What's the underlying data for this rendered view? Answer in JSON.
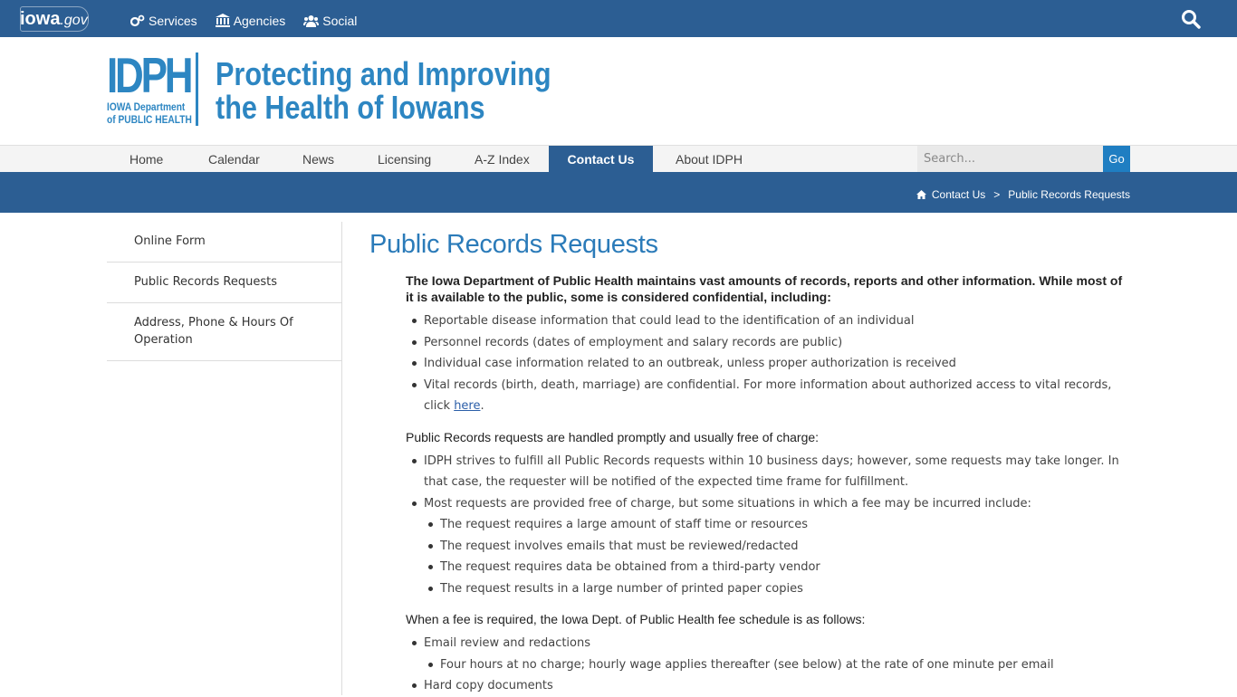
{
  "topbar": {
    "logo_main": "iowa",
    "logo_suffix": ".gov",
    "nav": [
      {
        "label": "Services",
        "icon": "gears-icon"
      },
      {
        "label": "Agencies",
        "icon": "building-icon"
      },
      {
        "label": "Social",
        "icon": "users-icon"
      }
    ],
    "search_icon": "search-icon"
  },
  "header": {
    "logo_letters": "IDPH",
    "logo_line1": "IOWA Department",
    "logo_line2": "of PUBLIC HEALTH",
    "tagline_line1": "Protecting and Improving",
    "tagline_line2": "the Health of Iowans"
  },
  "mainnav": {
    "items": [
      "Home",
      "Calendar",
      "News",
      "Licensing",
      "A-Z Index",
      "Contact Us",
      "About IDPH"
    ],
    "active": "Contact Us",
    "search_placeholder": "Search...",
    "go_label": "Go"
  },
  "breadcrumb": {
    "home_icon": "home-icon",
    "crumbs": [
      "Contact Us",
      "Public Records Requests"
    ],
    "separator": ">"
  },
  "sidebar": {
    "items": [
      "Online Form",
      "Public Records Requests",
      "Address, Phone & Hours Of Operation"
    ]
  },
  "content": {
    "title": "Public Records Requests",
    "intro": "The Iowa Department of Public Health maintains vast amounts of records, reports and other information. While most of it is available to the public, some is considered confidential, including:",
    "confidential": [
      "Reportable disease information that could lead to the identification of an individual",
      "Personnel records (dates of employment and salary records are public)",
      "Individual case information related to an outbreak, unless proper authorization is received"
    ],
    "vital_text": "Vital records (birth, death, marriage) are confidential. For more information about authorized access to vital records, click ",
    "vital_link": "here",
    "vital_end": ".",
    "section2": "Public Records requests are handled promptly and usually free of charge:",
    "handled": [
      "IDPH strives to fulfill all Public Records requests within 10 business days; however, some requests may take longer. In that case, the requester will be notified of the expected time frame for fulfillment."
    ],
    "fee_lead": "Most requests are provided free of charge, but some situations in which a fee may be incurred include:",
    "fee_situations": [
      "The request requires a large amount of staff time or resources",
      "The request involves emails that must be reviewed/redacted",
      "The request requires data be obtained from a third-party vendor",
      "The request results in a large number of printed paper copies"
    ],
    "section3": "When a fee is required, the Iowa Dept. of Public Health fee schedule is as follows:",
    "fee_item1": "Email review and redactions",
    "fee_item1_sub": "Four hours at no charge; hourly wage applies thereafter (see below) at the rate of one minute per email",
    "fee_item2": "Hard copy documents"
  }
}
